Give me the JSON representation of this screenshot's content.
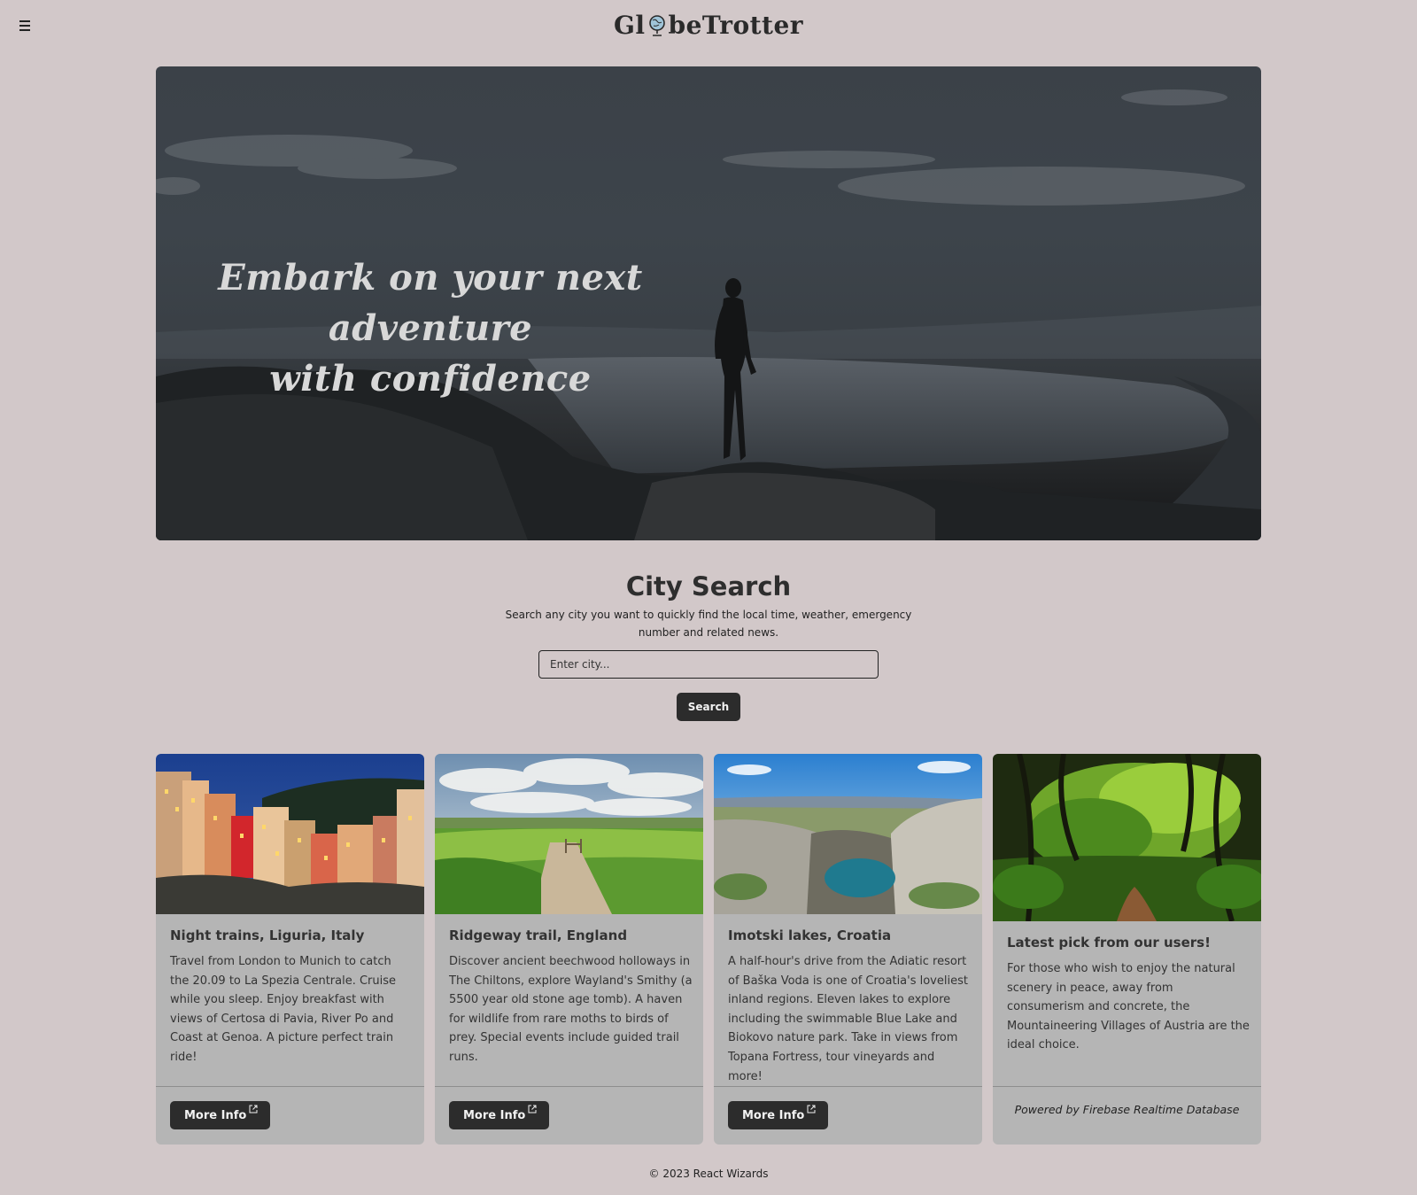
{
  "header": {
    "brand_left": "Gl",
    "brand_right": "beTrotter",
    "menu_icon": "hamburger-menu-icon",
    "brand_icon": "globe-icon"
  },
  "hero": {
    "line1": "Embark on your next adventure",
    "line2": "with confidence"
  },
  "search": {
    "title": "City Search",
    "description": "Search any city you want to quickly find the local time, weather, emergency number and related news.",
    "placeholder": "Enter city...",
    "button_label": "Search"
  },
  "cards": [
    {
      "title": "Night trains, Liguria, Italy",
      "text": "Travel from London to Munich to catch the 20.09 to La Spezia Centrale. Cruise while you sleep. Enjoy breakfast with views of Certosa di Pavia, River Po and Coast at Genoa. A picture perfect train ride!",
      "button_label": "More Info"
    },
    {
      "title": "Ridgeway trail, England",
      "text": "Discover ancient beechwood holloways in The Chiltons, explore Wayland's Smithy (a 5500 year old stone age tomb). A haven for wildlife from rare moths to birds of prey. Special events include guided trail runs.",
      "button_label": "More Info"
    },
    {
      "title": "Imotski lakes, Croatia",
      "text": "A half-hour's drive from the Adiatic resort of Baška Voda is one of Croatia's loveliest inland regions. Eleven lakes to explore including the swimmable Blue Lake and Biokovo nature park. Take in views from Topana Fortress, tour vineyards and more!",
      "button_label": "More Info"
    },
    {
      "title": "Latest pick from our users!",
      "text": "For those who wish to enjoy the natural scenery in peace, away from consumerism and concrete, the Mountaineering Villages of Austria are the ideal choice.",
      "footer_note": "Powered by Firebase Realtime Database"
    }
  ],
  "footer": {
    "copyright": "© 2023 React Wizards"
  },
  "colors": {
    "page_background": "#d2c8c9",
    "card_background": "#b5b5b5",
    "button_background": "#2c2c2c",
    "text": "#2b2b2b"
  }
}
